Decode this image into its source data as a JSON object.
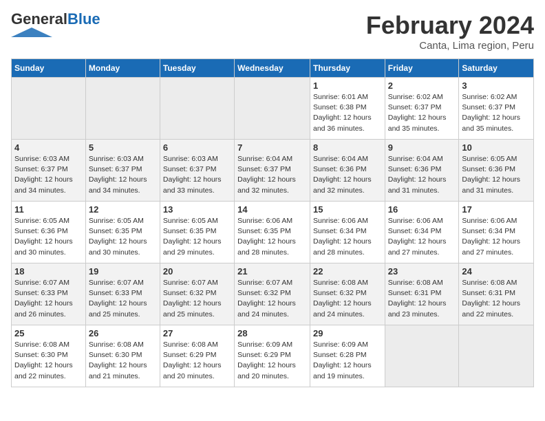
{
  "header": {
    "logo_general": "General",
    "logo_blue": "Blue",
    "month_title": "February 2024",
    "location": "Canta, Lima region, Peru"
  },
  "columns": [
    "Sunday",
    "Monday",
    "Tuesday",
    "Wednesday",
    "Thursday",
    "Friday",
    "Saturday"
  ],
  "weeks": [
    [
      {
        "day": "",
        "info": ""
      },
      {
        "day": "",
        "info": ""
      },
      {
        "day": "",
        "info": ""
      },
      {
        "day": "",
        "info": ""
      },
      {
        "day": "1",
        "info": "Sunrise: 6:01 AM\nSunset: 6:38 PM\nDaylight: 12 hours and 36 minutes."
      },
      {
        "day": "2",
        "info": "Sunrise: 6:02 AM\nSunset: 6:37 PM\nDaylight: 12 hours and 35 minutes."
      },
      {
        "day": "3",
        "info": "Sunrise: 6:02 AM\nSunset: 6:37 PM\nDaylight: 12 hours and 35 minutes."
      }
    ],
    [
      {
        "day": "4",
        "info": "Sunrise: 6:03 AM\nSunset: 6:37 PM\nDaylight: 12 hours and 34 minutes."
      },
      {
        "day": "5",
        "info": "Sunrise: 6:03 AM\nSunset: 6:37 PM\nDaylight: 12 hours and 34 minutes."
      },
      {
        "day": "6",
        "info": "Sunrise: 6:03 AM\nSunset: 6:37 PM\nDaylight: 12 hours and 33 minutes."
      },
      {
        "day": "7",
        "info": "Sunrise: 6:04 AM\nSunset: 6:37 PM\nDaylight: 12 hours and 32 minutes."
      },
      {
        "day": "8",
        "info": "Sunrise: 6:04 AM\nSunset: 6:36 PM\nDaylight: 12 hours and 32 minutes."
      },
      {
        "day": "9",
        "info": "Sunrise: 6:04 AM\nSunset: 6:36 PM\nDaylight: 12 hours and 31 minutes."
      },
      {
        "day": "10",
        "info": "Sunrise: 6:05 AM\nSunset: 6:36 PM\nDaylight: 12 hours and 31 minutes."
      }
    ],
    [
      {
        "day": "11",
        "info": "Sunrise: 6:05 AM\nSunset: 6:36 PM\nDaylight: 12 hours and 30 minutes."
      },
      {
        "day": "12",
        "info": "Sunrise: 6:05 AM\nSunset: 6:35 PM\nDaylight: 12 hours and 30 minutes."
      },
      {
        "day": "13",
        "info": "Sunrise: 6:05 AM\nSunset: 6:35 PM\nDaylight: 12 hours and 29 minutes."
      },
      {
        "day": "14",
        "info": "Sunrise: 6:06 AM\nSunset: 6:35 PM\nDaylight: 12 hours and 28 minutes."
      },
      {
        "day": "15",
        "info": "Sunrise: 6:06 AM\nSunset: 6:34 PM\nDaylight: 12 hours and 28 minutes."
      },
      {
        "day": "16",
        "info": "Sunrise: 6:06 AM\nSunset: 6:34 PM\nDaylight: 12 hours and 27 minutes."
      },
      {
        "day": "17",
        "info": "Sunrise: 6:06 AM\nSunset: 6:34 PM\nDaylight: 12 hours and 27 minutes."
      }
    ],
    [
      {
        "day": "18",
        "info": "Sunrise: 6:07 AM\nSunset: 6:33 PM\nDaylight: 12 hours and 26 minutes."
      },
      {
        "day": "19",
        "info": "Sunrise: 6:07 AM\nSunset: 6:33 PM\nDaylight: 12 hours and 25 minutes."
      },
      {
        "day": "20",
        "info": "Sunrise: 6:07 AM\nSunset: 6:32 PM\nDaylight: 12 hours and 25 minutes."
      },
      {
        "day": "21",
        "info": "Sunrise: 6:07 AM\nSunset: 6:32 PM\nDaylight: 12 hours and 24 minutes."
      },
      {
        "day": "22",
        "info": "Sunrise: 6:08 AM\nSunset: 6:32 PM\nDaylight: 12 hours and 24 minutes."
      },
      {
        "day": "23",
        "info": "Sunrise: 6:08 AM\nSunset: 6:31 PM\nDaylight: 12 hours and 23 minutes."
      },
      {
        "day": "24",
        "info": "Sunrise: 6:08 AM\nSunset: 6:31 PM\nDaylight: 12 hours and 22 minutes."
      }
    ],
    [
      {
        "day": "25",
        "info": "Sunrise: 6:08 AM\nSunset: 6:30 PM\nDaylight: 12 hours and 22 minutes."
      },
      {
        "day": "26",
        "info": "Sunrise: 6:08 AM\nSunset: 6:30 PM\nDaylight: 12 hours and 21 minutes."
      },
      {
        "day": "27",
        "info": "Sunrise: 6:08 AM\nSunset: 6:29 PM\nDaylight: 12 hours and 20 minutes."
      },
      {
        "day": "28",
        "info": "Sunrise: 6:09 AM\nSunset: 6:29 PM\nDaylight: 12 hours and 20 minutes."
      },
      {
        "day": "29",
        "info": "Sunrise: 6:09 AM\nSunset: 6:28 PM\nDaylight: 12 hours and 19 minutes."
      },
      {
        "day": "",
        "info": ""
      },
      {
        "day": "",
        "info": ""
      }
    ]
  ]
}
